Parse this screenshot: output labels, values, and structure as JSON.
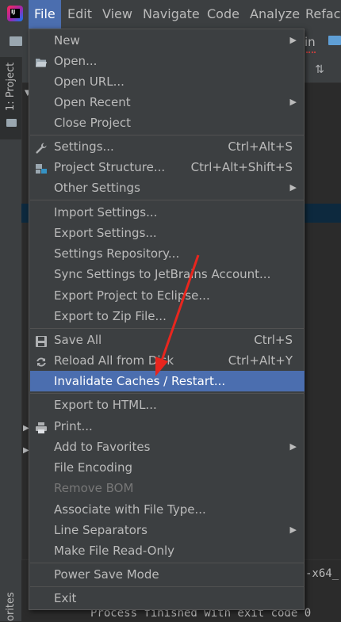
{
  "menubar": {
    "items": [
      {
        "label": "File",
        "active": true
      },
      {
        "label": "Edit"
      },
      {
        "label": "View"
      },
      {
        "label": "Navigate"
      },
      {
        "label": "Code"
      },
      {
        "label": "Analyze"
      },
      {
        "label": "Refact"
      }
    ]
  },
  "background": {
    "tab_fragment": "in",
    "project_tab_label": "1: Project",
    "favorites_label": "orites",
    "run_fragment": "-x64_",
    "console_line": "Process finished with exit code 0"
  },
  "file_menu": {
    "new": "New",
    "open": "Open...",
    "open_url": "Open URL...",
    "open_recent": "Open Recent",
    "close_project": "Close Project",
    "settings": "Settings...",
    "settings_shortcut": "Ctrl+Alt+S",
    "project_structure": "Project Structure...",
    "project_structure_shortcut": "Ctrl+Alt+Shift+S",
    "other_settings": "Other Settings",
    "import_settings": "Import Settings...",
    "export_settings": "Export Settings...",
    "settings_repository": "Settings Repository...",
    "sync_settings": "Sync Settings to JetBrains Account...",
    "export_eclipse": "Export Project to Eclipse...",
    "export_zip": "Export to Zip File...",
    "save_all": "Save All",
    "save_all_shortcut": "Ctrl+S",
    "reload_all": "Reload All from Disk",
    "reload_all_shortcut": "Ctrl+Alt+Y",
    "invalidate_caches": "Invalidate Caches / Restart...",
    "export_html": "Export to HTML...",
    "print": "Print...",
    "add_favorites": "Add to Favorites",
    "file_encoding": "File Encoding",
    "remove_bom": "Remove BOM",
    "associate_file_type": "Associate with File Type...",
    "line_separators": "Line Separators",
    "make_read_only": "Make File Read-Only",
    "power_save": "Power Save Mode",
    "exit": "Exit"
  },
  "colors": {
    "highlight": "#4b6eaf",
    "annotation_arrow": "#e8261e"
  }
}
